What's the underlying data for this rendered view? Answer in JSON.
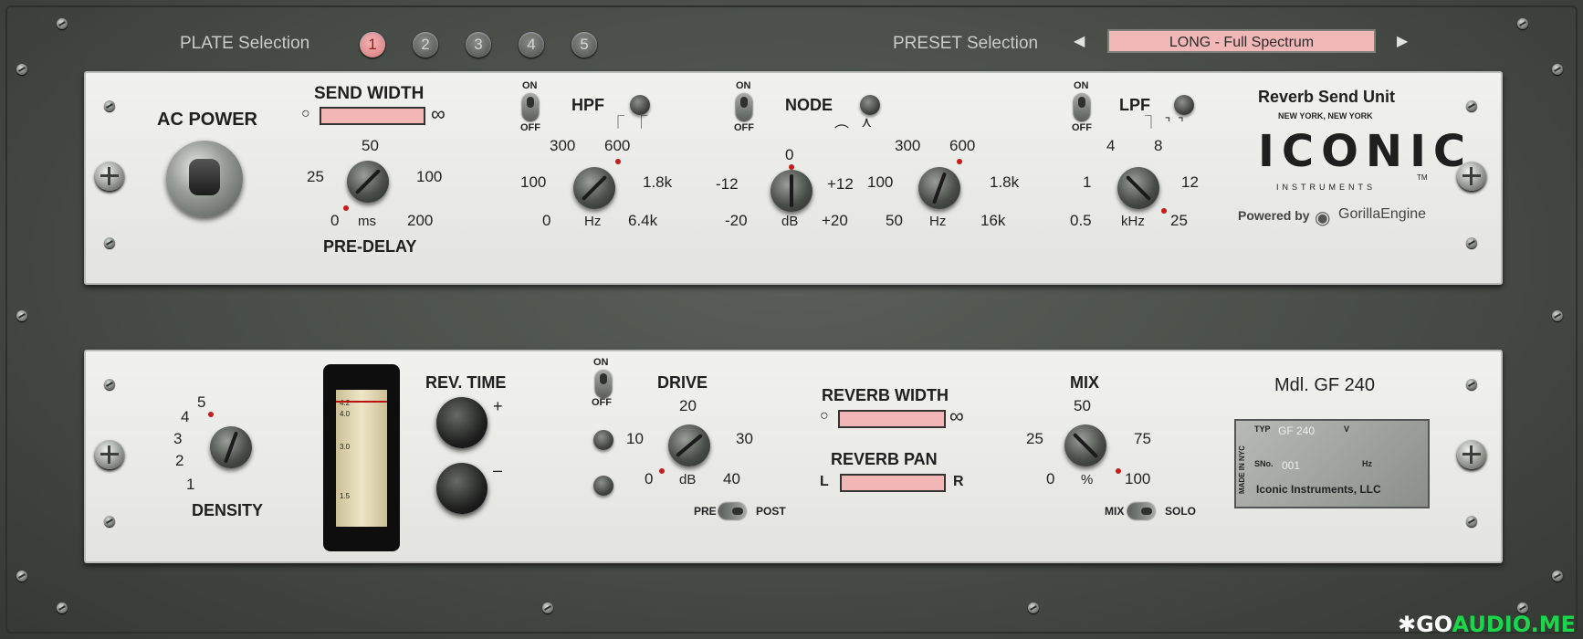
{
  "top_bar": {
    "plate_label": "PLATE Selection",
    "plates": [
      "1",
      "2",
      "3",
      "4",
      "5"
    ],
    "active_plate": "1",
    "preset_label": "PRESET Selection",
    "preset_value": "LONG - Full Spectrum",
    "prev_arrow": "◀",
    "next_arrow": "▶"
  },
  "top_panel": {
    "ac_power": "AC POWER",
    "send_width": "SEND WIDTH",
    "send_width_min": "○",
    "send_width_max": "∞",
    "pre_delay": {
      "label": "PRE-DELAY",
      "unit": "ms",
      "ticks": [
        "0",
        "25",
        "50",
        "100",
        "200"
      ]
    },
    "hpf": {
      "label": "HPF",
      "switch_on": "ON",
      "switch_off": "OFF",
      "unit": "Hz",
      "ticks": [
        "0",
        "100",
        "300",
        "600",
        "1.8k",
        "6.4k"
      ]
    },
    "node": {
      "label": "NODE",
      "switch_on": "ON",
      "switch_off": "OFF",
      "gain_unit": "dB",
      "gain_ticks": [
        "-20",
        "-12",
        "0",
        "+12",
        "+20"
      ],
      "freq_unit": "Hz",
      "freq_ticks": [
        "50",
        "100",
        "300",
        "600",
        "1.8k",
        "16k"
      ]
    },
    "lpf": {
      "label": "LPF",
      "switch_on": "ON",
      "switch_off": "OFF",
      "unit": "kHz",
      "ticks": [
        "0.5",
        "1",
        "4",
        "8",
        "12",
        "25"
      ]
    },
    "brand": {
      "title": "Reverb Send Unit",
      "city": "NEW YORK, NEW YORK",
      "logo": "ICONIC",
      "sub": "INSTRUMENTS",
      "tm": "TM",
      "powered": "Powered by",
      "engine": "GorillaEngine"
    }
  },
  "bottom_panel": {
    "density": {
      "label": "DENSITY",
      "ticks": [
        "1",
        "2",
        "3",
        "4",
        "5"
      ]
    },
    "rev_time": {
      "label": "REV. TIME",
      "plus": "+",
      "minus": "–"
    },
    "drive": {
      "label": "DRIVE",
      "switch_on": "ON",
      "switch_off": "OFF",
      "unit": "dB",
      "ticks": [
        "0",
        "10",
        "20",
        "30",
        "40"
      ],
      "pre": "PRE",
      "post": "POST"
    },
    "reverb_width": {
      "label": "REVERB WIDTH",
      "min": "○",
      "max": "∞"
    },
    "reverb_pan": {
      "label": "REVERB PAN",
      "left": "L",
      "right": "R"
    },
    "mix": {
      "label": "MIX",
      "unit": "%",
      "ticks": [
        "0",
        "25",
        "50",
        "75",
        "100"
      ],
      "mix": "MIX",
      "solo": "SOLO"
    },
    "model": {
      "title": "Mdl. GF 240",
      "made_in": "MADE IN NYC",
      "typ": "TYP",
      "typ_value": "GF 240",
      "v": "V",
      "sn": "SNo.",
      "sn_value": "001",
      "hz": "Hz",
      "company": "Iconic Instruments, LLC"
    },
    "meter_marks": [
      "4.2",
      "4.0",
      "3.0",
      "1.5"
    ]
  },
  "watermark": {
    "a": "GO",
    "b": "AUDIO.ME"
  },
  "colors": {
    "panel": "#eeeeea",
    "rack": "#4b5049",
    "pink": "#f3b6b6",
    "led": "#c21c1c"
  }
}
